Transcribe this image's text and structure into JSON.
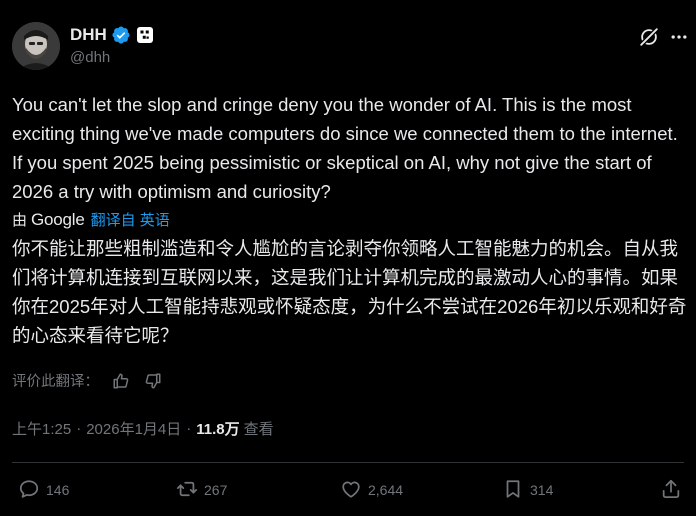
{
  "author": {
    "display_name": "DHH",
    "handle": "@dhh"
  },
  "tweet": {
    "text": "You can't let the slop and cringe deny you the wonder of AI. This is the most exciting thing we've made computers do since we connected them to the internet. If you spent 2025 being pessimistic or skeptical on AI, why not give the start of 2026 a try with optimism and curiosity?",
    "translated_by_prefix": "由",
    "translated_by_brand": "Google",
    "translate_link": "翻译自 英语",
    "translated_text": "你不能让那些粗制滥造和令人尴尬的言论剥夺你领略人工智能魅力的机会。自从我们将计算机连接到互联网以来，这是我们让计算机完成的最激动人心的事情。如果你在2025年对人工智能持悲观或怀疑态度，为什么不尝试在2026年初以乐观和好奇的心态来看待它呢？",
    "rate_label": "评价此翻译："
  },
  "meta": {
    "time": "上午1:25",
    "separator": "·",
    "date": "2026年1月4日",
    "views_count": "11.8万",
    "views_label": "查看"
  },
  "actions": {
    "replies": "146",
    "reposts": "267",
    "likes": "2,644",
    "bookmarks": "314"
  },
  "colors": {
    "background": "#000000",
    "text": "#e7e9ea",
    "muted": "#71767b",
    "accent": "#1d9bf0",
    "divider": "#2f3336"
  },
  "icons": {
    "verified": "verified-badge-icon",
    "affiliation": "affiliation-badge-icon",
    "grok": "grok-icon",
    "more": "more-icon",
    "thumbs_up": "thumbs-up-icon",
    "thumbs_down": "thumbs-down-icon",
    "reply": "reply-icon",
    "repost": "repost-icon",
    "like": "like-icon",
    "bookmark": "bookmark-icon",
    "share": "share-icon"
  }
}
